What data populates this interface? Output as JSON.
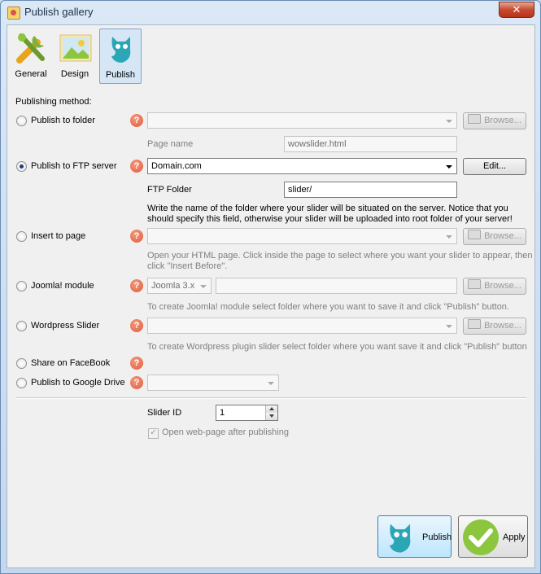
{
  "window": {
    "title": "Publish gallery",
    "close_glyph": "✕"
  },
  "tabs": [
    {
      "label": "General",
      "icon": "tools-icon"
    },
    {
      "label": "Design",
      "icon": "picture-icon"
    },
    {
      "label": "Publish",
      "icon": "owl-icon",
      "active": true
    }
  ],
  "form": {
    "section_label": "Publishing method:",
    "help_glyph": "?",
    "browse_label": "Browse...",
    "edit_label": "Edit...",
    "folder": {
      "label": "Publish to folder",
      "path": "",
      "page_name_label": "Page name",
      "page_name_value": "wowslider.html"
    },
    "ftp": {
      "label": "Publish to FTP server",
      "selected": true,
      "server": "Domain.com",
      "folder_label": "FTP Folder",
      "folder_value": "slider/",
      "note_line1": "Write the name of the folder where your slider will be situated on the server. Notice that you",
      "note_line2": "should specify this field, otherwise your slider will be uploaded into root folder of your server!"
    },
    "insert": {
      "label": "Insert to page",
      "path": "",
      "note_line1": "Open your HTML page. Click inside the page to select where you want your slider to appear, then",
      "note_line2": "click \"Insert Before\"."
    },
    "joomla": {
      "label": "Joomla! module",
      "version": "Joomla 3.x",
      "path": "",
      "note": "To create Joomla! module select folder where you want to save it and click \"Publish\" button."
    },
    "wordpress": {
      "label": "Wordpress Slider",
      "path": "",
      "note": "To create Wordpress plugin slider select folder where you want save it and click \"Publish\" button"
    },
    "facebook": {
      "label": "Share on FaceBook"
    },
    "gdrive": {
      "label": "Publish to Google Drive",
      "value": ""
    },
    "slider_id_label": "Slider ID",
    "slider_id_value": "1",
    "open_after_label": "Open web-page after publishing",
    "open_after_checked": true,
    "check_glyph": "✓"
  },
  "actions": {
    "publish_label": "Publish",
    "apply_label": "Apply"
  },
  "colors": {
    "help": "#e05a3a",
    "owl": "#2aa6b5",
    "apply": "#8cc63f"
  }
}
